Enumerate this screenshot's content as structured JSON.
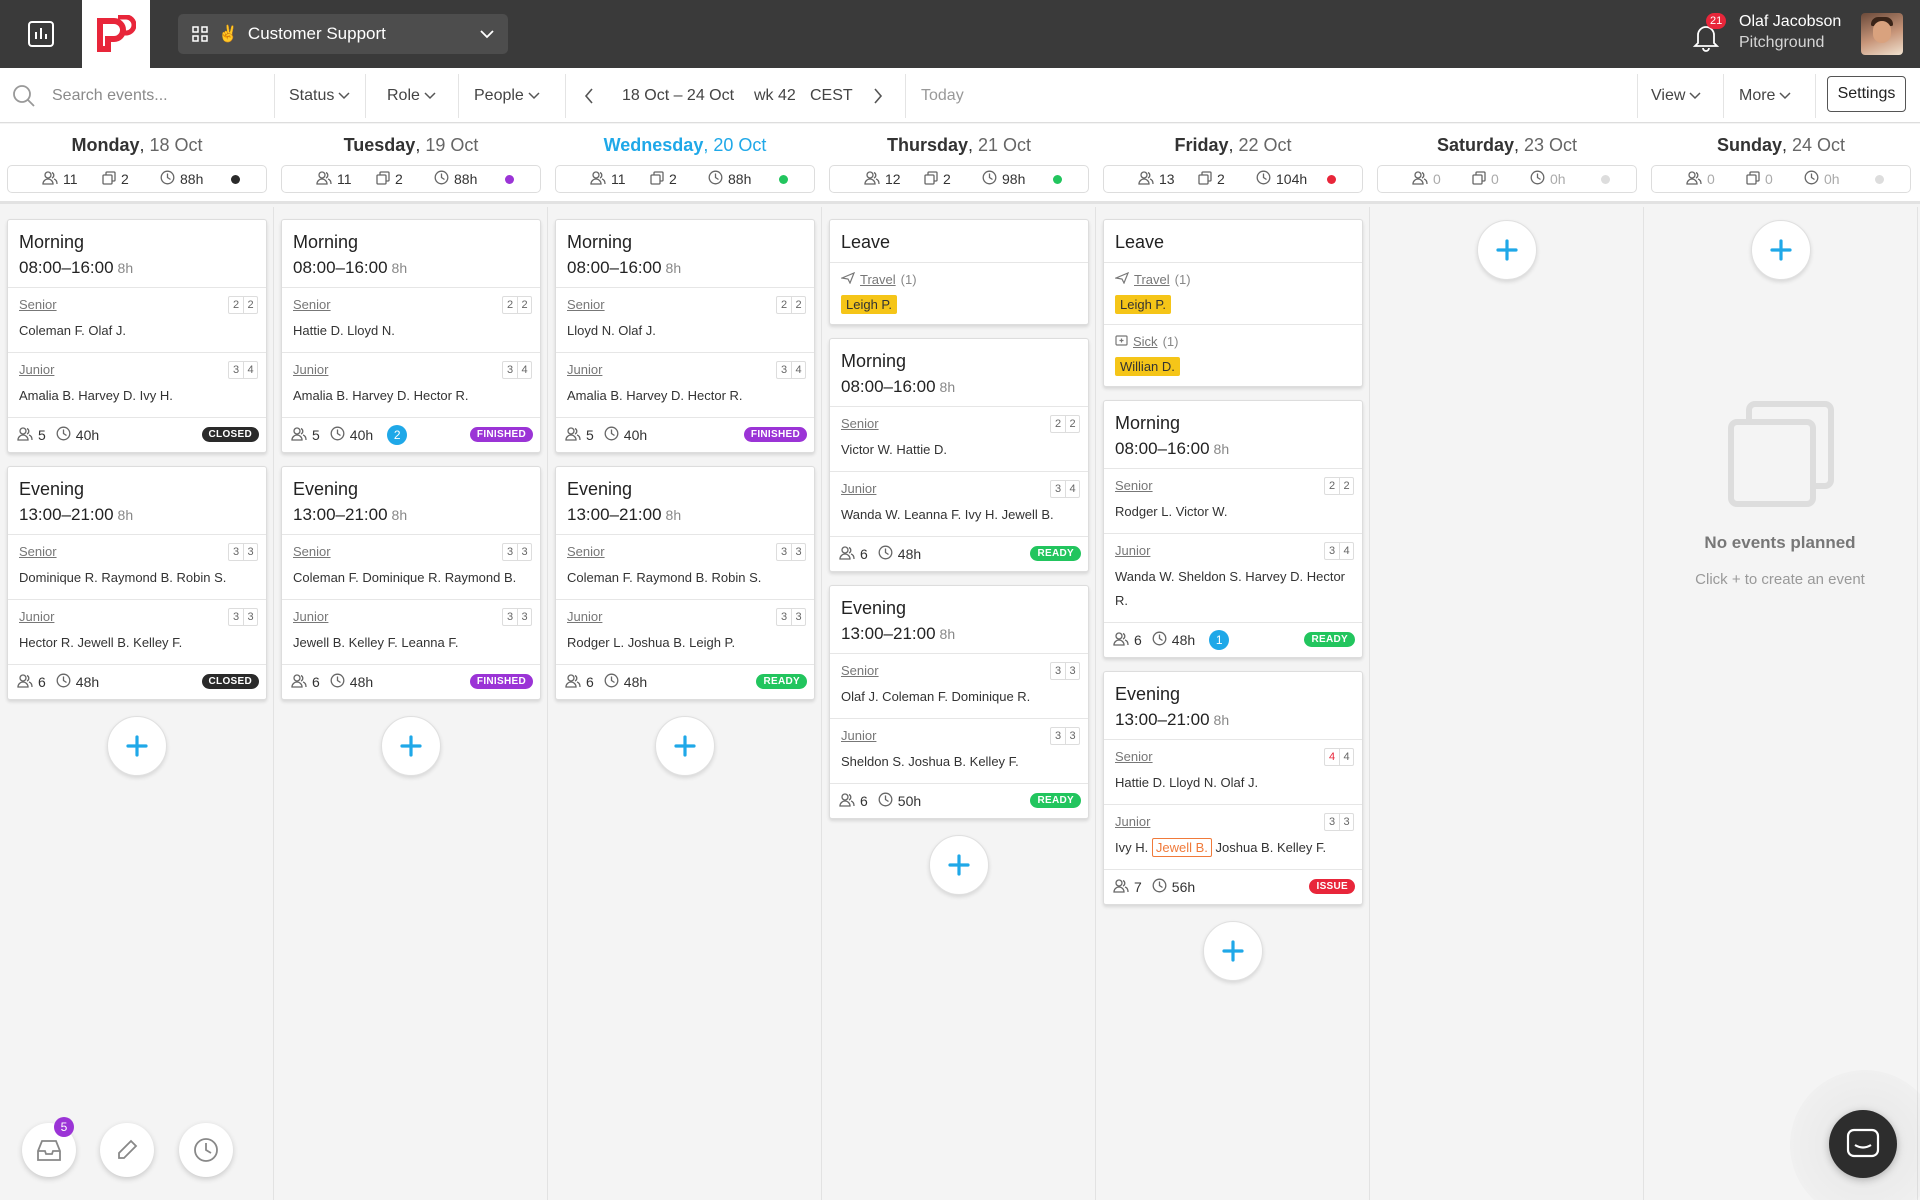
{
  "topbar": {
    "team_name": "Customer Support",
    "team_emoji": "✌",
    "notif_count": "21",
    "user_name": "Olaf Jacobson",
    "user_org": "Pitchground"
  },
  "toolbar": {
    "search_placeholder": "Search events...",
    "status": "Status",
    "role": "Role",
    "people": "People",
    "date_range": "18 Oct – 24 Oct",
    "week": "wk 42",
    "tz": "CEST",
    "today": "Today",
    "view": "View",
    "more": "More",
    "settings": "Settings"
  },
  "days": [
    {
      "dow": "Monday",
      "date": "18 Oct",
      "people": "11",
      "events": "2",
      "hours": "88h",
      "dot": "#2a2a2a"
    },
    {
      "dow": "Tuesday",
      "date": "19 Oct",
      "people": "11",
      "events": "2",
      "hours": "88h",
      "dot": "#9b34d6"
    },
    {
      "dow": "Wednesday",
      "date": "20 Oct",
      "people": "11",
      "events": "2",
      "hours": "88h",
      "dot": "#22c55e"
    },
    {
      "dow": "Thursday",
      "date": "21 Oct",
      "people": "12",
      "events": "2",
      "hours": "98h",
      "dot": "#22c55e"
    },
    {
      "dow": "Friday",
      "date": "22 Oct",
      "people": "13",
      "events": "2",
      "hours": "104h",
      "dot": "#e8263a"
    },
    {
      "dow": "Saturday",
      "date": "23 Oct",
      "people": "0",
      "events": "0",
      "hours": "0h",
      "dot": "#dddddd"
    },
    {
      "dow": "Sunday",
      "date": "24 Oct",
      "people": "0",
      "events": "0",
      "hours": "0h",
      "dot": "#dddddd"
    }
  ],
  "columns": [
    [
      {
        "name": "Morning",
        "time": "08:00–16:00",
        "dur": "8h",
        "sections": [
          {
            "role": "Senior",
            "a": "2",
            "b": "2",
            "people": "Coleman F. Olaf J."
          },
          {
            "role": "Junior",
            "a": "3",
            "b": "4",
            "people": "Amalia B. Harvey D. Ivy H."
          }
        ],
        "count": "5",
        "hours": "40h",
        "status": "CLOSED",
        "status_color": "#2a2a2a"
      },
      {
        "name": "Evening",
        "time": "13:00–21:00",
        "dur": "8h",
        "sections": [
          {
            "role": "Senior",
            "a": "3",
            "b": "3",
            "people": "Dominique R. Raymond B. Robin S."
          },
          {
            "role": "Junior",
            "a": "3",
            "b": "3",
            "people": "Hector R. Jewell B. Kelley F."
          }
        ],
        "count": "6",
        "hours": "48h",
        "status": "CLOSED",
        "status_color": "#2a2a2a"
      }
    ],
    [
      {
        "name": "Morning",
        "time": "08:00–16:00",
        "dur": "8h",
        "sections": [
          {
            "role": "Senior",
            "a": "2",
            "b": "2",
            "people": "Hattie D. Lloyd N."
          },
          {
            "role": "Junior",
            "a": "3",
            "b": "4",
            "people": "Amalia B. Harvey D. Hector R."
          }
        ],
        "count": "5",
        "hours": "40h",
        "comments": "2",
        "status": "FINISHED",
        "status_color": "#9b34d6"
      },
      {
        "name": "Evening",
        "time": "13:00–21:00",
        "dur": "8h",
        "sections": [
          {
            "role": "Senior",
            "a": "3",
            "b": "3",
            "people": "Coleman F. Dominique R. Raymond B."
          },
          {
            "role": "Junior",
            "a": "3",
            "b": "3",
            "people": "Jewell B. Kelley F. Leanna F."
          }
        ],
        "count": "6",
        "hours": "48h",
        "status": "FINISHED",
        "status_color": "#9b34d6"
      }
    ],
    [
      {
        "name": "Morning",
        "time": "08:00–16:00",
        "dur": "8h",
        "sections": [
          {
            "role": "Senior",
            "a": "2",
            "b": "2",
            "people": "Lloyd N. Olaf J."
          },
          {
            "role": "Junior",
            "a": "3",
            "b": "4",
            "people": "Amalia B. Harvey D. Hector R."
          }
        ],
        "count": "5",
        "hours": "40h",
        "status": "FINISHED",
        "status_color": "#9b34d6"
      },
      {
        "name": "Evening",
        "time": "13:00–21:00",
        "dur": "8h",
        "sections": [
          {
            "role": "Senior",
            "a": "3",
            "b": "3",
            "people": "Coleman F. Raymond B. Robin S."
          },
          {
            "role": "Junior",
            "a": "3",
            "b": "3",
            "people": "Rodger L. Joshua B. Leigh P."
          }
        ],
        "count": "6",
        "hours": "48h",
        "status": "READY",
        "status_color": "#22c55e"
      }
    ],
    [
      {
        "leave": true,
        "name": "Leave",
        "rows": [
          {
            "type": "Travel",
            "n": "(1)",
            "person": "Leigh P.",
            "icon": "plane"
          }
        ]
      },
      {
        "name": "Morning",
        "time": "08:00–16:00",
        "dur": "8h",
        "sections": [
          {
            "role": "Senior",
            "a": "2",
            "b": "2",
            "people": "Victor W. Hattie D."
          },
          {
            "role": "Junior",
            "a": "3",
            "b": "4",
            "people": "Wanda W. Leanna F. Ivy H. Jewell B."
          }
        ],
        "count": "6",
        "hours": "48h",
        "status": "READY",
        "status_color": "#22c55e"
      },
      {
        "name": "Evening",
        "time": "13:00–21:00",
        "dur": "8h",
        "sections": [
          {
            "role": "Senior",
            "a": "3",
            "b": "3",
            "people": "Olaf J. Coleman F. Dominique R."
          },
          {
            "role": "Junior",
            "a": "3",
            "b": "3",
            "people": "Sheldon S. Joshua B. Kelley F."
          }
        ],
        "count": "6",
        "hours": "50h",
        "status": "READY",
        "status_color": "#22c55e"
      }
    ],
    [
      {
        "leave": true,
        "name": "Leave",
        "rows": [
          {
            "type": "Travel",
            "n": "(1)",
            "person": "Leigh P.",
            "icon": "plane"
          },
          {
            "type": "Sick",
            "n": "(1)",
            "person": "Willian D.",
            "icon": "sick"
          }
        ]
      },
      {
        "name": "Morning",
        "time": "08:00–16:00",
        "dur": "8h",
        "sections": [
          {
            "role": "Senior",
            "a": "2",
            "b": "2",
            "people": "Rodger L. Victor W."
          },
          {
            "role": "Junior",
            "a": "3",
            "b": "4",
            "people": "Wanda W. Sheldon S. Harvey D. Hector R."
          }
        ],
        "count": "6",
        "hours": "48h",
        "comments": "1",
        "status": "READY",
        "status_color": "#22c55e"
      },
      {
        "name": "Evening",
        "time": "13:00–21:00",
        "dur": "8h",
        "sections": [
          {
            "role": "Senior",
            "a": "4",
            "b": "4",
            "a_red": true,
            "people": "Hattie D. Lloyd N. Olaf J."
          },
          {
            "role": "Junior",
            "a": "3",
            "b": "3",
            "people_pre": "Ivy H.",
            "people_issue": "Jewell B.",
            "people_post": "Joshua B. Kelley F."
          }
        ],
        "count": "7",
        "hours": "56h",
        "status": "ISSUE",
        "status_color": "#e8263a"
      }
    ],
    [],
    []
  ],
  "empty_state": {
    "title": "No events planned",
    "hint": "Click + to create an event"
  },
  "fab": {
    "inbox_count": "5"
  }
}
